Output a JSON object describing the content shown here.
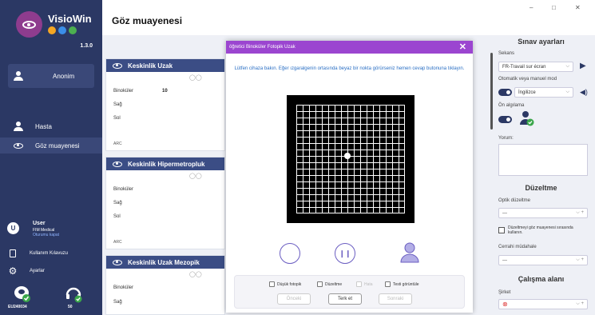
{
  "app": {
    "name": "VisioWin",
    "version": "1.3.0",
    "brand_dot_colors": [
      "#f5a623",
      "#3b8ee8",
      "#4caf50"
    ]
  },
  "sidebar": {
    "patient_label": "Anonim",
    "items": [
      {
        "label": "Hasta",
        "icon": "person-icon"
      },
      {
        "label": "Göz muayenesi",
        "icon": "eye-icon"
      }
    ],
    "user": {
      "initial": "U",
      "name": "User",
      "org": "FIM Medical",
      "logout": "Oturumu kapat"
    },
    "bottom_items": [
      {
        "label": "Kullanım Kılavuzu",
        "icon": "manual-icon"
      },
      {
        "label": "Ayarlar",
        "icon": "gear-icon"
      }
    ],
    "device_id": "EU240034",
    "audio_value": "50"
  },
  "header": {
    "title": "Göz muayenesi",
    "window_controls": [
      "–",
      "□",
      "✕"
    ]
  },
  "cards": [
    {
      "title": "Keskinlik Uzak",
      "rows": [
        {
          "label": "Binoküler",
          "value": "10"
        },
        {
          "label": "Sağ",
          "value": ""
        },
        {
          "label": "Sol",
          "value": ""
        }
      ]
    },
    {
      "title": "Keskinlik Hipermetropluk",
      "rows": [
        {
          "label": "Binoküler",
          "value": ""
        },
        {
          "label": "Sağ",
          "value": ""
        },
        {
          "label": "Sol",
          "value": ""
        }
      ]
    },
    {
      "title": "Keskinlik Uzak Mezopik",
      "rows": [
        {
          "label": "Binoküler",
          "value": ""
        },
        {
          "label": "Sağ",
          "value": ""
        }
      ]
    }
  ],
  "card_footer_label": "ARC",
  "right_panel": {
    "exam_settings_title": "Sınav ayarları",
    "sequence_label": "Sekans",
    "sequence_value": "FR-Travail sur écran",
    "mode_label": "Otomatik veya manuel mod",
    "language_value": "İngilizce",
    "detection_label": "Ön algılama",
    "comment_label": "Yorum:",
    "correction_title": "Düzeltme",
    "optical_correction_label": "Optik düzeltme",
    "optical_correction_value": "---",
    "correction_checkbox_label": "Düzeltmeyi göz muayenesi sırasında kullanın.",
    "surgical_label": "Cerrahi müdahale",
    "surgical_value": "---",
    "workspace_title": "Çalışma alanı",
    "company_label": "Şirket"
  },
  "modal": {
    "title": "öğretici Binoküler Fotopik Uzak",
    "message": "Lütfen cihaza bakın. Eğer ızgaralgenin ortasında beyaz bir nokta görürseniz hemen cevap butonuna tıklayın.",
    "checkboxes": [
      {
        "label": "Düşük fotopik",
        "enabled": true
      },
      {
        "label": "Düzeltme",
        "enabled": true
      },
      {
        "label": "Hata",
        "enabled": false
      },
      {
        "label": "Testi görüntüle",
        "enabled": true
      }
    ],
    "buttons": {
      "prev": "Önceki",
      "leave": "Terk et",
      "next": "Sonraki"
    }
  }
}
